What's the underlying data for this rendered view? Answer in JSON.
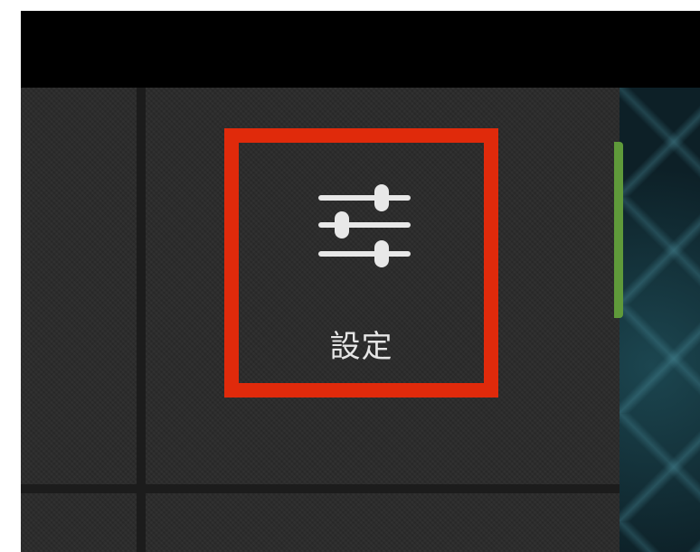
{
  "settings": {
    "label": "設定",
    "icon": "sliders-icon",
    "highlight_color": "#e02a0b"
  }
}
